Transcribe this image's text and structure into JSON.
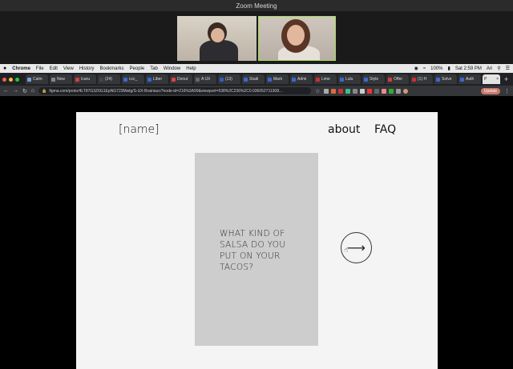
{
  "zoom": {
    "title": "Zoom Meeting"
  },
  "mac_menubar": {
    "apple": "",
    "items": [
      "Chrome",
      "File",
      "Edit",
      "View",
      "History",
      "Bookmarks",
      "People",
      "Tab",
      "Window",
      "Help"
    ],
    "battery": "100%",
    "clock": "Sat 2:59 PM",
    "user": "Ari"
  },
  "chrome": {
    "tabs": [
      {
        "label": "Calm",
        "color": "#7aa0d8"
      },
      {
        "label": "New",
        "color": "#888888"
      },
      {
        "label": "Icaru",
        "color": "#d04040"
      },
      {
        "label": "(24)",
        "color": "#444444"
      },
      {
        "label": "ccc_",
        "color": "#3a6ad0"
      },
      {
        "label": "Liber",
        "color": "#2c6ad8"
      },
      {
        "label": "Donut",
        "color": "#dd4444"
      },
      {
        "label": "A UX",
        "color": "#666666"
      },
      {
        "label": "(13)",
        "color": "#2e5fbd"
      },
      {
        "label": "Studi",
        "color": "#3a6ad0"
      },
      {
        "label": "Mark",
        "color": "#3a6ad0"
      },
      {
        "label": "Admi",
        "color": "#3a6ad0"
      },
      {
        "label": "Lime",
        "color": "#cc3030"
      },
      {
        "label": "Lulu",
        "color": "#3a6ad0"
      },
      {
        "label": "Style",
        "color": "#3a6ad0"
      },
      {
        "label": "Offer",
        "color": "#d04040"
      },
      {
        "label": "(1) H",
        "color": "#cc3030"
      },
      {
        "label": "Solve",
        "color": "#3a6ad0"
      },
      {
        "label": "Auth",
        "color": "#3a6ad0"
      }
    ],
    "active_tab_label": "P",
    "url": "figma.com/proto/4LT87G3Z6G1EpNG723Mwlg/S-UX-Brainiacs?node-id=216%3A99&viewport=538%2C236%2C0.036052711308...",
    "update_label": "Update"
  },
  "page": {
    "brand": "[name]",
    "nav": {
      "about": "about",
      "faq": "FAQ"
    },
    "question": "WHAT KIND OF\nSALSA DO YOU\nPUT ON YOUR\nTACOS?",
    "next_arrow": "⟶",
    "cursor": "☝"
  },
  "colors": {
    "frame_bg": "#f4f4f4",
    "card_bg": "#cdcdcd",
    "speaker_highlight": "#9fdf55"
  }
}
